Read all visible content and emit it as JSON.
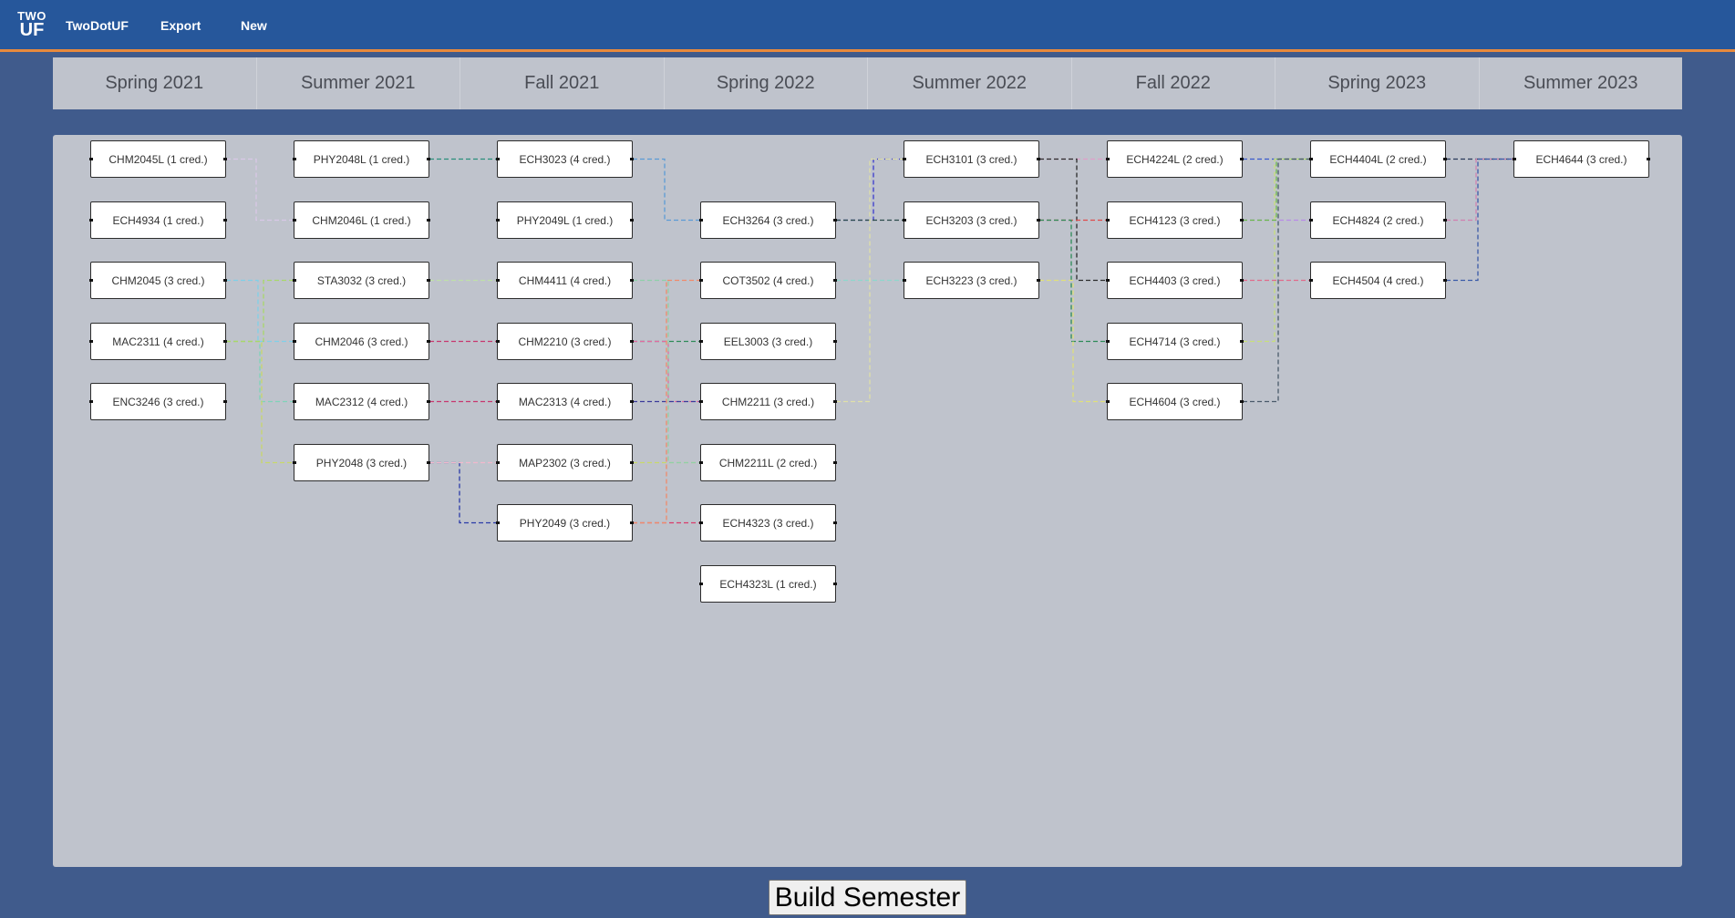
{
  "navbar": {
    "logo_top": "TWO",
    "logo_bottom": "UF",
    "links": [
      "TwoDotUF",
      "Export",
      "New"
    ]
  },
  "semesters": [
    "Spring 2021",
    "Summer 2021",
    "Fall 2021",
    "Spring 2022",
    "Summer 2022",
    "Fall 2022",
    "Spring 2023",
    "Summer 2023"
  ],
  "courses": [
    {
      "label": "CHM2045L (1 cred.)",
      "sem": 0,
      "row": 0
    },
    {
      "label": "ECH4934 (1 cred.)",
      "sem": 0,
      "row": 1
    },
    {
      "label": "CHM2045 (3 cred.)",
      "sem": 0,
      "row": 2
    },
    {
      "label": "MAC2311 (4 cred.)",
      "sem": 0,
      "row": 3
    },
    {
      "label": "ENC3246 (3 cred.)",
      "sem": 0,
      "row": 4
    },
    {
      "label": "PHY2048L (1 cred.)",
      "sem": 1,
      "row": 0
    },
    {
      "label": "CHM2046L (1 cred.)",
      "sem": 1,
      "row": 1
    },
    {
      "label": "STA3032 (3 cred.)",
      "sem": 1,
      "row": 2
    },
    {
      "label": "CHM2046 (3 cred.)",
      "sem": 1,
      "row": 3
    },
    {
      "label": "MAC2312 (4 cred.)",
      "sem": 1,
      "row": 4
    },
    {
      "label": "PHY2048 (3 cred.)",
      "sem": 1,
      "row": 5
    },
    {
      "label": "ECH3023 (4 cred.)",
      "sem": 2,
      "row": 0
    },
    {
      "label": "PHY2049L (1 cred.)",
      "sem": 2,
      "row": 1
    },
    {
      "label": "CHM4411 (4 cred.)",
      "sem": 2,
      "row": 2
    },
    {
      "label": "CHM2210 (3 cred.)",
      "sem": 2,
      "row": 3
    },
    {
      "label": "MAC2313 (4 cred.)",
      "sem": 2,
      "row": 4
    },
    {
      "label": "MAP2302 (3 cred.)",
      "sem": 2,
      "row": 5
    },
    {
      "label": "PHY2049 (3 cred.)",
      "sem": 2,
      "row": 6
    },
    {
      "label": "ECH3264 (3 cred.)",
      "sem": 3,
      "row": 1
    },
    {
      "label": "COT3502 (4 cred.)",
      "sem": 3,
      "row": 2
    },
    {
      "label": "EEL3003 (3 cred.)",
      "sem": 3,
      "row": 3
    },
    {
      "label": "CHM2211 (3 cred.)",
      "sem": 3,
      "row": 4
    },
    {
      "label": "CHM2211L (2 cred.)",
      "sem": 3,
      "row": 5
    },
    {
      "label": "ECH4323 (3 cred.)",
      "sem": 3,
      "row": 6
    },
    {
      "label": "ECH4323L (1 cred.)",
      "sem": 3,
      "row": 7
    },
    {
      "label": "ECH3101 (3 cred.)",
      "sem": 4,
      "row": 0
    },
    {
      "label": "ECH3203 (3 cred.)",
      "sem": 4,
      "row": 1
    },
    {
      "label": "ECH3223 (3 cred.)",
      "sem": 4,
      "row": 2
    },
    {
      "label": "ECH4224L (2 cred.)",
      "sem": 5,
      "row": 0
    },
    {
      "label": "ECH4123 (3 cred.)",
      "sem": 5,
      "row": 1
    },
    {
      "label": "ECH4403 (3 cred.)",
      "sem": 5,
      "row": 2
    },
    {
      "label": "ECH4714 (3 cred.)",
      "sem": 5,
      "row": 3
    },
    {
      "label": "ECH4604 (3 cred.)",
      "sem": 5,
      "row": 4
    },
    {
      "label": "ECH4404L (2 cred.)",
      "sem": 6,
      "row": 0
    },
    {
      "label": "ECH4824 (2 cred.)",
      "sem": 6,
      "row": 1
    },
    {
      "label": "ECH4504 (4 cred.)",
      "sem": 6,
      "row": 2
    },
    {
      "label": "ECH4644 (3 cred.)",
      "sem": 7,
      "row": 0
    }
  ],
  "prerequisites": [
    {
      "from": "CHM2045L (1 cred.)",
      "to": "CHM2046L (1 cred.)",
      "color": "#d9c8e6"
    },
    {
      "from": "CHM2045 (3 cred.)",
      "to": "CHM2046 (3 cred.)",
      "color": "#7fd0e8"
    },
    {
      "from": "MAC2311 (4 cred.)",
      "to": "MAC2312 (4 cred.)",
      "color": "#7fd3b8"
    },
    {
      "from": "MAC2311 (4 cred.)",
      "to": "PHY2048 (3 cred.)",
      "color": "#c8d86a"
    },
    {
      "from": "MAC2311 (4 cred.)",
      "to": "STA3032 (3 cred.)",
      "color": "#a8d86a"
    },
    {
      "from": "PHY2048 (3 cred.)",
      "to": "PHY2049 (3 cred.)",
      "color": "#2a3aa8"
    },
    {
      "from": "PHY2048L (1 cred.)",
      "to": "ECH3023 (4 cred.)",
      "color": "#2b8f7a"
    },
    {
      "from": "PHY2048 (3 cred.)",
      "to": "MAP2302 (3 cred.)",
      "color": "#f2b8cc"
    },
    {
      "from": "CHM2046 (3 cred.)",
      "to": "CHM2210 (3 cred.)",
      "color": "#c8376f"
    },
    {
      "from": "MAC2312 (4 cred.)",
      "to": "MAC2313 (4 cred.)",
      "color": "#c8376f"
    },
    {
      "from": "STA3032 (3 cred.)",
      "to": "CHM4411 (4 cred.)",
      "color": "#bfe0a8"
    },
    {
      "from": "ECH3023 (4 cred.)",
      "to": "ECH3264 (3 cred.)",
      "color": "#5b9bd5"
    },
    {
      "from": "CHM2210 (3 cred.)",
      "to": "EEL3003 (3 cred.)",
      "color": "#2e8b57"
    },
    {
      "from": "CHM2210 (3 cred.)",
      "to": "CHM2211 (3 cred.)",
      "color": "#e26ba0"
    },
    {
      "from": "MAC2313 (4 cred.)",
      "to": "CHM2211 (3 cred.)",
      "color": "#3a3a9a"
    },
    {
      "from": "MAP2302 (3 cred.)",
      "to": "CHM2211L (2 cred.)",
      "color": "#c8d86a"
    },
    {
      "from": "PHY2049 (3 cred.)",
      "to": "ECH4323 (3 cred.)",
      "color": "#d93a6a"
    },
    {
      "from": "PHY2049 (3 cred.)",
      "to": "COT3502 (4 cred.)",
      "color": "#f08a6a"
    },
    {
      "from": "CHM4411 (4 cred.)",
      "to": "CHM2211L (2 cred.)",
      "color": "#8fd0a8"
    },
    {
      "from": "ECH3264 (3 cred.)",
      "to": "ECH3101 (3 cred.)",
      "color": "#3a3acc"
    },
    {
      "from": "ECH3264 (3 cred.)",
      "to": "ECH3203 (3 cred.)",
      "color": "#2b4a4a"
    },
    {
      "from": "COT3502 (4 cred.)",
      "to": "ECH3223 (3 cred.)",
      "color": "#8fd6cc"
    },
    {
      "from": "CHM2211 (3 cred.)",
      "to": "ECH3101 (3 cred.)",
      "color": "#e0e0a8"
    },
    {
      "from": "ECH3101 (3 cred.)",
      "to": "ECH4224L (2 cred.)",
      "color": "#e0a0c8"
    },
    {
      "from": "ECH3101 (3 cred.)",
      "to": "ECH4403 (3 cred.)",
      "color": "#2b2b2b"
    },
    {
      "from": "ECH3203 (3 cred.)",
      "to": "ECH4123 (3 cred.)",
      "color": "#e04a4a"
    },
    {
      "from": "ECH3203 (3 cred.)",
      "to": "ECH4714 (3 cred.)",
      "color": "#2e8b57"
    },
    {
      "from": "ECH3223 (3 cred.)",
      "to": "ECH4604 (3 cred.)",
      "color": "#e0e07a"
    },
    {
      "from": "ECH4224L (2 cred.)",
      "to": "ECH4404L (2 cred.)",
      "color": "#3a5acc"
    },
    {
      "from": "ECH4123 (3 cred.)",
      "to": "ECH4824 (2 cred.)",
      "color": "#b88ae6"
    },
    {
      "from": "ECH4403 (3 cred.)",
      "to": "ECH4504 (4 cred.)",
      "color": "#e06a8a"
    },
    {
      "from": "ECH4714 (3 cred.)",
      "to": "ECH4404L (2 cred.)",
      "color": "#c8e07a"
    },
    {
      "from": "ECH4123 (3 cred.)",
      "to": "ECH4404L (2 cred.)",
      "color": "#6ab84a"
    },
    {
      "from": "ECH4604 (3 cred.)",
      "to": "ECH4404L (2 cred.)",
      "color": "#4a5a6a"
    },
    {
      "from": "ECH4404L (2 cred.)",
      "to": "ECH4644 (3 cred.)",
      "color": "#2b3a5a"
    },
    {
      "from": "ECH4824 (2 cred.)",
      "to": "ECH4644 (3 cred.)",
      "color": "#d080b0"
    },
    {
      "from": "ECH4504 (4 cred.)",
      "to": "ECH4644 (3 cred.)",
      "color": "#3a5aa8"
    }
  ],
  "build_button": "Build Semester"
}
